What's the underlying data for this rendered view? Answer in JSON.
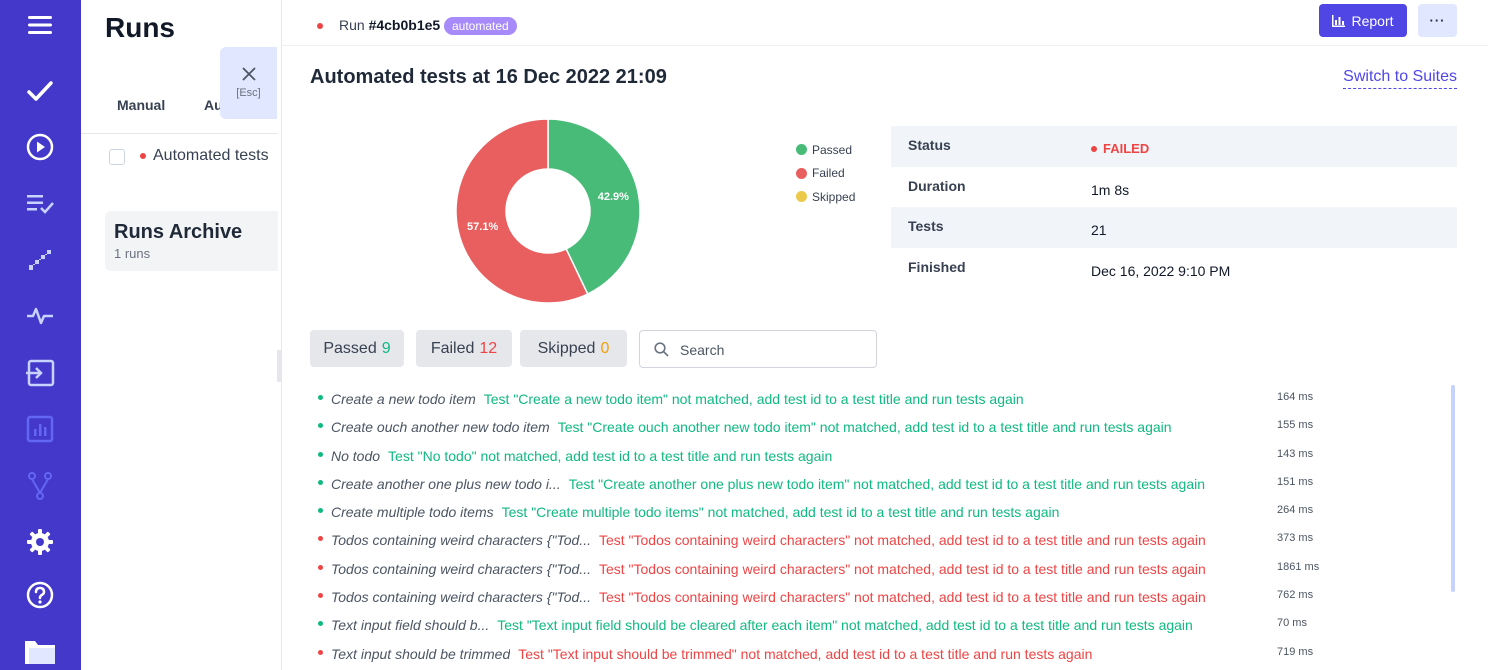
{
  "nav": {
    "items": [
      "menu-icon",
      "check-icon",
      "play-circle-icon",
      "list-check-icon",
      "steps-icon",
      "pulse-icon",
      "import-icon",
      "chart-icon",
      "branch-icon",
      "gear-icon",
      "help-icon",
      "folder-icon"
    ]
  },
  "runs_panel": {
    "title": "Runs",
    "tabs": [
      "Manual",
      "Au"
    ],
    "run_item": "Automated tests",
    "archive_title": "Runs Archive",
    "archive_count": "1 runs",
    "close_hint": "[Esc]"
  },
  "header": {
    "run_label": "Run ",
    "run_id": "#4cb0b1e5",
    "tag": "automated",
    "report_label": "Report",
    "more_label": "···"
  },
  "main": {
    "title": "Automated tests at 16 Dec 2022 21:09",
    "switch_link": "Switch to Suites"
  },
  "chart_data": {
    "type": "pie",
    "categories": [
      "Passed",
      "Failed",
      "Skipped"
    ],
    "values": [
      42.9,
      57.1,
      0
    ],
    "data_labels": [
      "42.9%",
      "57.1%",
      ""
    ],
    "colors": [
      "#48bb78",
      "#e95f5f",
      "#ecc94b"
    ],
    "donut": true,
    "legend_position": "right"
  },
  "stats": [
    {
      "key": "Status",
      "value": "FAILED"
    },
    {
      "key": "Duration",
      "value": "1m 8s"
    },
    {
      "key": "Tests",
      "value": "21"
    },
    {
      "key": "Finished",
      "value": "Dec 16, 2022 9:10 PM"
    }
  ],
  "filters": {
    "passed_label": "Passed",
    "passed_count": "9",
    "failed_label": "Failed",
    "failed_count": "12",
    "skipped_label": "Skipped",
    "skipped_count": "0",
    "search_placeholder": "Search"
  },
  "colors": {
    "pass": "#10b981",
    "fail": "#ef4444",
    "accent": "#4f46e5",
    "nav": "#4338ca"
  },
  "tests": [
    {
      "status": "pass",
      "title": "Create a new todo item",
      "message": "Test \"Create a new todo item\" not matched, add test id to a test title and run tests again",
      "duration": "164 ms"
    },
    {
      "status": "pass",
      "title": "Create ouch another new todo item",
      "message": "Test \"Create ouch another new todo item\" not matched, add test id to a test title and run tests again",
      "duration": "155 ms"
    },
    {
      "status": "pass",
      "title": "No todo",
      "message": "Test \"No todo\" not matched, add test id to a test title and run tests again",
      "duration": "143 ms"
    },
    {
      "status": "pass",
      "title": "Create another one plus new todo i...",
      "message": "Test \"Create another one plus new todo item\" not matched, add test id to a test title and run tests again",
      "duration": "151 ms"
    },
    {
      "status": "pass",
      "title": "Create multiple todo items",
      "message": "Test \"Create multiple todo items\" not matched, add test id to a test title and run tests again",
      "duration": "264 ms"
    },
    {
      "status": "fail",
      "title": "Todos containing weird characters {\"Tod...",
      "message": "Test \"Todos containing weird characters\" not matched, add test id to a test title and run tests again",
      "duration": "373 ms"
    },
    {
      "status": "fail",
      "title": "Todos containing weird characters {\"Tod...",
      "message": "Test \"Todos containing weird characters\" not matched, add test id to a test title and run tests again",
      "duration": "1861 ms"
    },
    {
      "status": "fail",
      "title": "Todos containing weird characters {\"Tod...",
      "message": "Test \"Todos containing weird characters\" not matched, add test id to a test title and run tests again",
      "duration": "762 ms"
    },
    {
      "status": "pass",
      "title": "Text input field should b...",
      "message": "Test \"Text input field should be cleared after each item\" not matched, add test id to a test title and run tests again",
      "duration": "70 ms"
    },
    {
      "status": "fail",
      "title": "Text input should be trimmed",
      "message": "Test \"Text input should be trimmed\" not matched, add test id to a test title and run tests again",
      "duration": "719 ms"
    }
  ]
}
